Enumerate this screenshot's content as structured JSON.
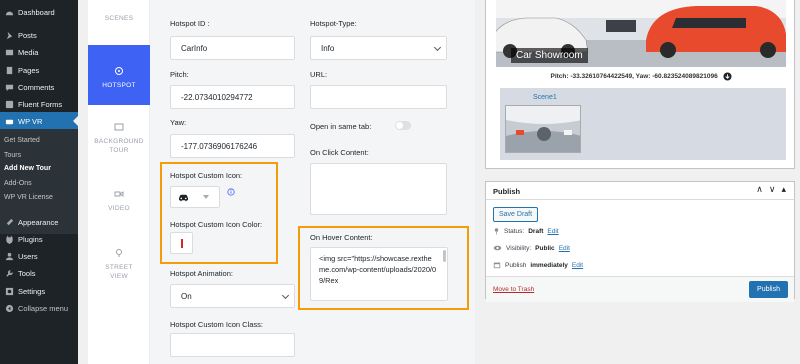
{
  "wp_menu": {
    "items": [
      {
        "label": "Dashboard",
        "icon": "dashboard-icon"
      },
      {
        "label": "Posts",
        "icon": "pin-icon"
      },
      {
        "label": "Media",
        "icon": "media-icon"
      },
      {
        "label": "Pages",
        "icon": "page-icon"
      },
      {
        "label": "Comments",
        "icon": "comment-icon"
      },
      {
        "label": "Fluent Forms",
        "icon": "form-icon"
      },
      {
        "label": "WP VR",
        "icon": "vr-icon"
      }
    ],
    "submenu": [
      "Get Started",
      "Tours",
      "Add New Tour",
      "Add-Ons",
      "WP VR License"
    ],
    "lower_items": [
      {
        "label": "Appearance",
        "icon": "brush-icon"
      },
      {
        "label": "Plugins",
        "icon": "plugin-icon"
      },
      {
        "label": "Users",
        "icon": "users-icon"
      },
      {
        "label": "Tools",
        "icon": "wrench-icon"
      },
      {
        "label": "Settings",
        "icon": "settings-icon"
      }
    ],
    "collapse": "Collapse menu",
    "accent": "#2271b1"
  },
  "tabs": {
    "scenes": "SCENES",
    "hotspot": "HOTSPOT",
    "background_tour_1": "BACKGROUND",
    "background_tour_2": "TOUR",
    "video": "VIDEO",
    "street_view_1": "STREET",
    "street_view_2": "VIEW",
    "active_color": "#3d62f4"
  },
  "form": {
    "hotspot_id_label": "Hotspot ID :",
    "hotspot_id_value": "CarInfo",
    "pitch_label": "Pitch:",
    "pitch_value": "-22.0734010294772",
    "yaw_label": "Yaw:",
    "yaw_value": "-177.0736906176246",
    "custom_icon_label": "Hotspot Custom Icon:",
    "custom_icon_name": "car-icon",
    "custom_icon_color_label": "Hotspot Custom Icon Color:",
    "custom_icon_color": "#d72629",
    "animation_label": "Hotspot Animation:",
    "animation_value": "On",
    "icon_class_label": "Hotspot Custom Icon Class:",
    "type_label": "Hotspot-Type:",
    "type_value": "Info",
    "url_label": "URL:",
    "open_same_tab_label": "Open in same tab:",
    "on_click_label": "On Click Content:",
    "on_hover_label": "On Hover Content:",
    "on_hover_value": "<img src=\"https://showcase.rextheme.com/wp-content/uploads/2020/09/Rex",
    "highlight_color": "#f59c0b"
  },
  "preview": {
    "car_label": "Car Showroom",
    "pitch_yaw": "Pitch: -33.32610764422549, Yaw: -60.823524089821096",
    "scene_label": "Scene1"
  },
  "publish": {
    "title": "Publish",
    "save_draft": "Save Draft",
    "status_label": "Status:",
    "status_value": "Draft",
    "visibility_label": "Visibility:",
    "visibility_value": "Public",
    "publish_label": "Publish",
    "publish_value": "immediately",
    "edit": "Edit",
    "trash": "Move to Trash",
    "publish_button": "Publish"
  }
}
